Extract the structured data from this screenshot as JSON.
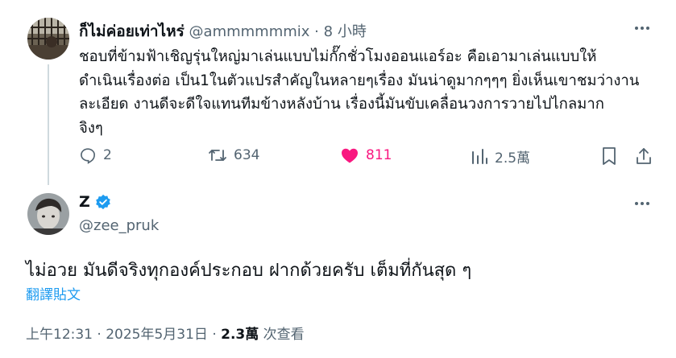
{
  "quoted_tweet": {
    "display_name": "ก็ไม่ค่อยเท่าไหร่",
    "handle": "@ammmmmmix",
    "separator": "·",
    "time_ago": "8 小時",
    "body_lines": [
      "ชอบที่ข้ามฟ้าเชิญรุ่นใหญ่มาเล่นแบบไม่กั๊กชั่วโมงออนแอร์อะ คือเอามาเล่นแบบให้",
      "ดำเนินเรื่องต่อ เป็น1ในตัวแปรสำคัญในหลายๆเรื่อง มันน่าดูมากๆๆๆ ยิ่งเห็นเขาชมว่างาน",
      "ละเอียด งานดีจะดีใจแทนทีมข้างหลังบ้าน เรื่องนี้มันขับเคลื่อนวงการวายไปไกลมาก",
      "จิงๆ"
    ],
    "actions": {
      "replies": "2",
      "reposts": "634",
      "likes": "811",
      "views": "2.5萬"
    },
    "liked": true
  },
  "main_tweet": {
    "display_name": "Z",
    "handle": "@zee_pruk",
    "verified": true,
    "body": "ไม่อวย มันดีจริงทุกองค์ประกอบ ฝากด้วยครับ เต็มที่กันสุด ๆ",
    "translate_label": "翻譯貼文",
    "timestamp": "上午12:31 · 2025年5月31日",
    "separator": "·",
    "views_count": "2.3萬",
    "views_label": "次查看"
  },
  "colors": {
    "accent": "#1d9bf0",
    "like": "#f91880",
    "muted_text": "#536471",
    "thread_line": "#cfd9de"
  },
  "icons": [
    "more-icon",
    "reply-icon",
    "repost-icon",
    "heart-icon",
    "views-icon",
    "bookmark-icon",
    "share-icon",
    "verified-badge-icon"
  ]
}
